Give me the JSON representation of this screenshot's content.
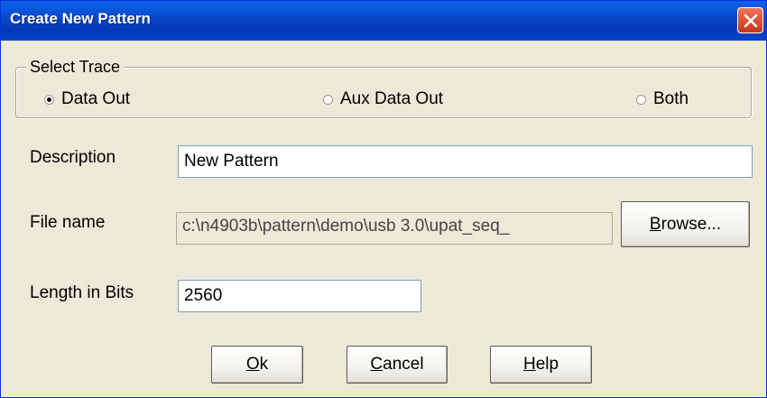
{
  "window": {
    "title": "Create New Pattern",
    "close_icon": "close-icon"
  },
  "select_trace": {
    "legend": "Select Trace",
    "options": [
      {
        "label": "Data Out",
        "selected": true
      },
      {
        "label": "Aux Data Out",
        "selected": false
      },
      {
        "label": "Both",
        "selected": false
      }
    ]
  },
  "description": {
    "label": "Description",
    "value": "New Pattern"
  },
  "file_name": {
    "label": "File name",
    "value": "c:\\n4903b\\pattern\\demo\\usb 3.0\\upat_seq_",
    "browse_first": "B",
    "browse_rest": "rowse..."
  },
  "length": {
    "label": "Length in Bits",
    "value": "2560"
  },
  "buttons": {
    "ok_first": "O",
    "ok_rest": "k",
    "cancel_first": "C",
    "cancel_rest": "ancel",
    "help_first": "H",
    "help_rest": "elp"
  },
  "colors": {
    "titlebar": "#0845c9",
    "close_button": "#e0553a",
    "dialog_bg": "#ece9d8"
  }
}
